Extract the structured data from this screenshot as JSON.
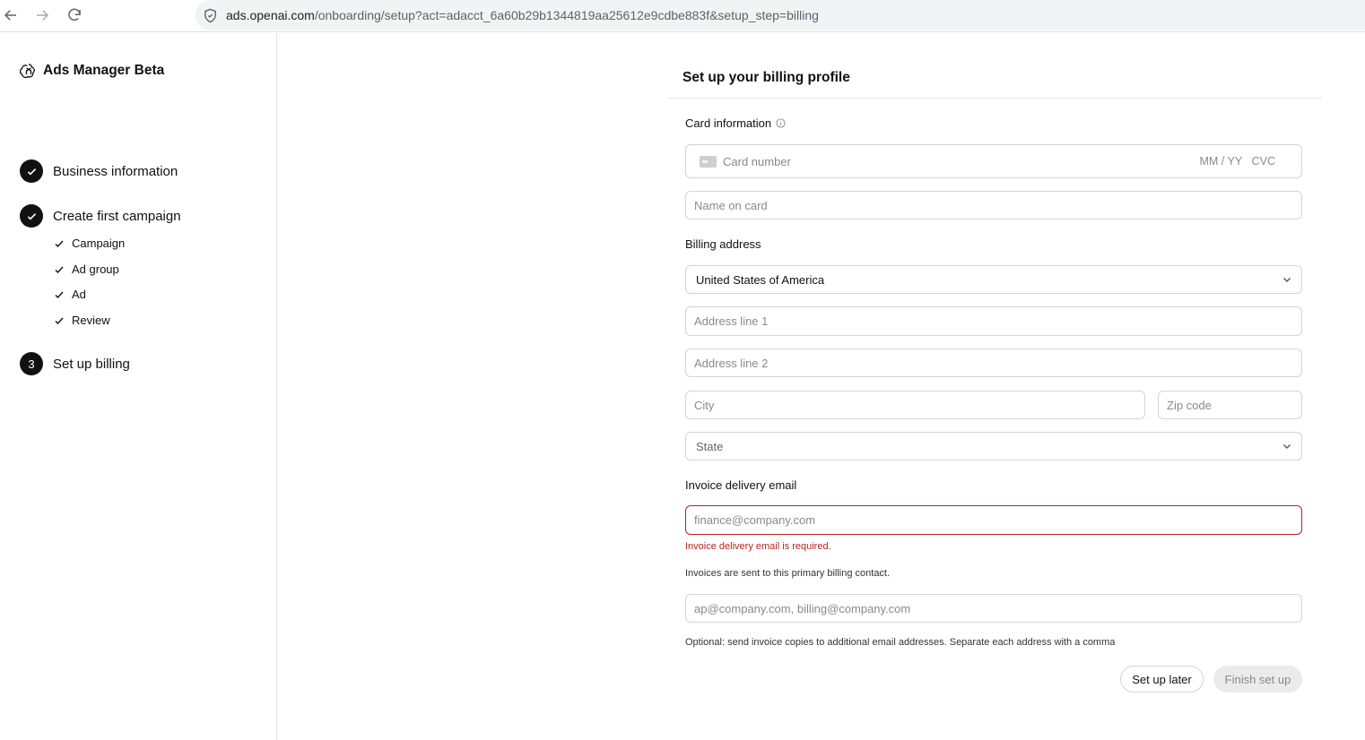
{
  "browser": {
    "url_domain": "ads.openai.com",
    "url_path": "/onboarding/setup?act=adacct_6a60b29b1344819aa25612e9cdbe883f&setup_step=billing"
  },
  "sidebar": {
    "brand": "Ads Manager Beta",
    "steps": [
      {
        "label": "Business information",
        "status": "complete"
      },
      {
        "label": "Create first campaign",
        "status": "complete"
      },
      {
        "label": "Set up billing",
        "status": "current",
        "number": "3"
      }
    ],
    "substeps": [
      "Campaign",
      "Ad group",
      "Ad",
      "Review"
    ]
  },
  "form": {
    "title": "Set up your billing profile",
    "card_section_label": "Card information",
    "card_number_placeholder": "Card number",
    "card_expiry_placeholder": "MM / YY",
    "card_cvc_placeholder": "CVC",
    "name_on_card_placeholder": "Name on card",
    "billing_address_label": "Billing address",
    "country_value": "United States of America",
    "address1_placeholder": "Address line 1",
    "address2_placeholder": "Address line 2",
    "city_placeholder": "City",
    "zip_placeholder": "Zip code",
    "state_placeholder": "State",
    "invoice_email_label": "Invoice delivery email",
    "invoice_email_placeholder": "finance@company.com",
    "invoice_email_error": "Invoice delivery email is required.",
    "invoice_email_help": "Invoices are sent to this primary billing contact.",
    "additional_emails_placeholder": "ap@company.com, billing@company.com",
    "additional_emails_help": "Optional: send invoice copies to additional email addresses. Separate each address with a comma",
    "setup_later_label": "Set up later",
    "finish_label": "Finish set up"
  },
  "colors": {
    "error": "#b3261e",
    "accent": "#111111"
  }
}
